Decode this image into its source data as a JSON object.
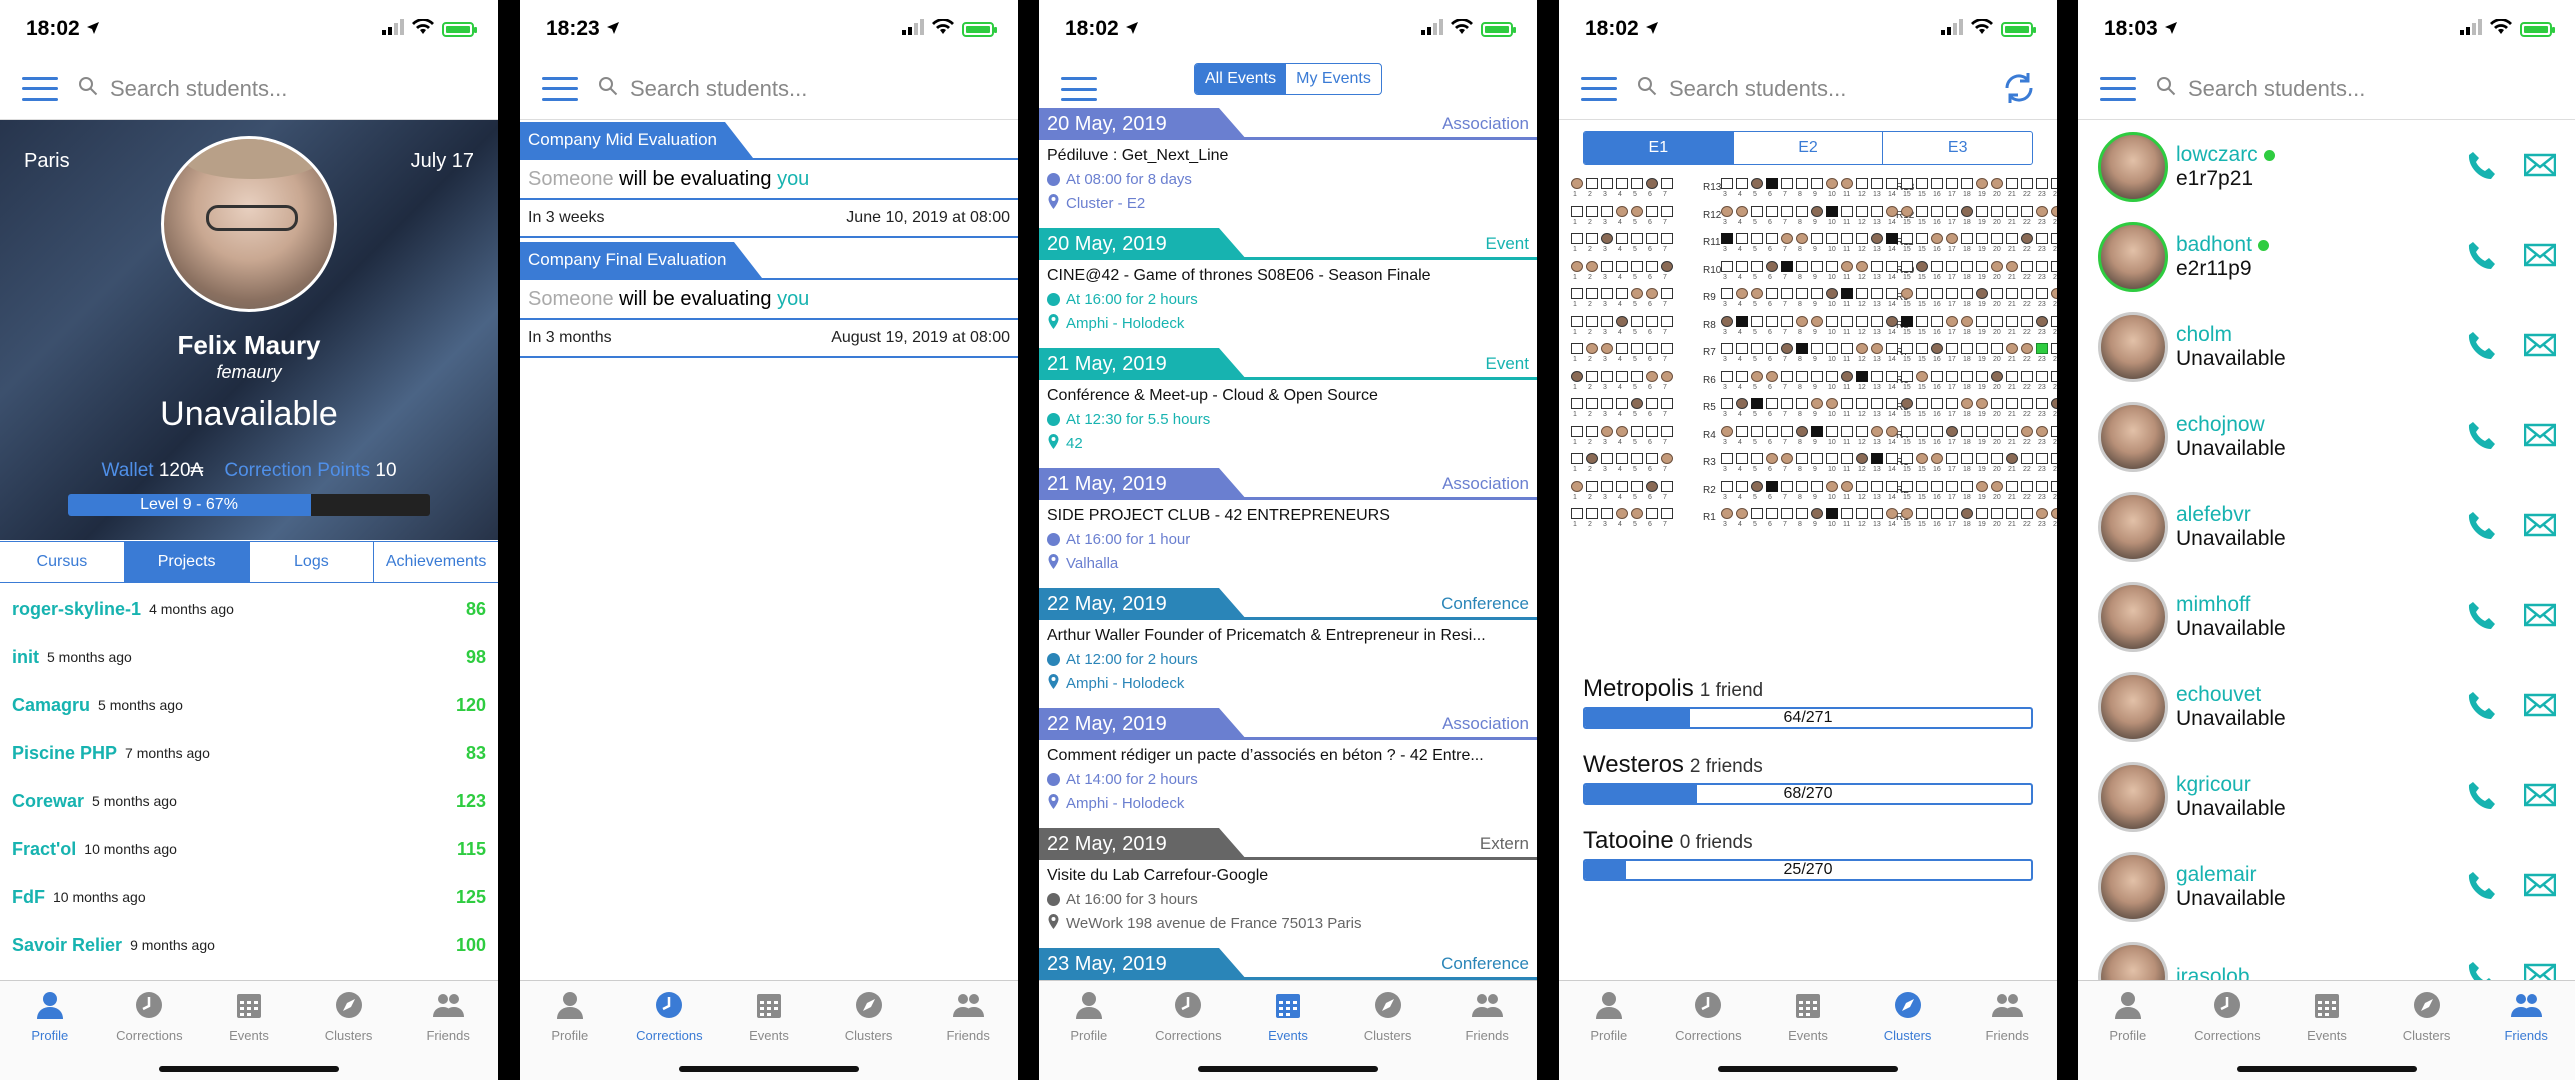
{
  "colors": {
    "accent": "#3a7bd5",
    "teal": "#17b3b0",
    "green": "#2ecc40",
    "purple": "#6a7fd0",
    "gray": "#666666"
  },
  "screens": [
    {
      "time": "18:02"
    },
    {
      "time": "18:23"
    },
    {
      "time": "18:02"
    },
    {
      "time": "18:02"
    },
    {
      "time": "18:03"
    }
  ],
  "search_placeholder": "Search students...",
  "tabs": [
    {
      "label": "Profile",
      "icon": "person-icon"
    },
    {
      "label": "Corrections",
      "icon": "clock-icon"
    },
    {
      "label": "Events",
      "icon": "calendar-icon"
    },
    {
      "label": "Clusters",
      "icon": "compass-icon"
    },
    {
      "label": "Friends",
      "icon": "people-icon"
    }
  ],
  "profile": {
    "city": "Paris",
    "date": "July 17",
    "name": "Felix Maury",
    "login": "femaury",
    "status": "Unavailable",
    "wallet_label": "Wallet",
    "wallet_value": "120₳",
    "cp_label": "Correction Points",
    "cp_value": "10",
    "level_text": "Level 9 - 67%",
    "level_progress": 0.67,
    "segments": [
      "Cursus",
      "Projects",
      "Logs",
      "Achievements"
    ],
    "projects": [
      {
        "name": "roger-skyline-1",
        "time": "4 months ago",
        "score": "86"
      },
      {
        "name": "init",
        "time": "5 months ago",
        "score": "98"
      },
      {
        "name": "Camagru",
        "time": "5 months ago",
        "score": "120"
      },
      {
        "name": "Piscine PHP",
        "time": "7 months ago",
        "score": "83"
      },
      {
        "name": "Corewar",
        "time": "5 months ago",
        "score": "123"
      },
      {
        "name": "Fract'ol",
        "time": "10 months ago",
        "score": "115"
      },
      {
        "name": "FdF",
        "time": "10 months ago",
        "score": "125"
      },
      {
        "name": "Savoir Relier",
        "time": "9 months ago",
        "score": "100"
      }
    ]
  },
  "corrections": [
    {
      "title": "Company Mid Evaluation",
      "someone": "Someone",
      "middle": " will be evaluating ",
      "you": "you",
      "when": "In 3 weeks",
      "date": "June 10, 2019 at 08:00"
    },
    {
      "title": "Company Final Evaluation",
      "someone": "Someone",
      "middle": " will be evaluating ",
      "you": "you",
      "when": "In 3 months",
      "date": "August 19, 2019 at 08:00"
    }
  ],
  "events_toggle": [
    "All Events",
    "My Events"
  ],
  "events": [
    {
      "date": "20 May, 2019",
      "category": "Association",
      "color": "#6a7fd0",
      "title": "Pédiluve : Get_Next_Line",
      "when": "At 08:00 for 8 days",
      "where": "Cluster - E2"
    },
    {
      "date": "20 May, 2019",
      "category": "Event",
      "color": "#17b3b0",
      "title": "CINE@42 - Game of thrones S08E06 - Season Finale",
      "when": "At 16:00 for 2 hours",
      "where": "Amphi - Holodeck"
    },
    {
      "date": "21 May, 2019",
      "category": "Event",
      "color": "#17b3b0",
      "title": "Conférence & Meet-up - Cloud & Open Source",
      "when": "At 12:30 for 5.5 hours",
      "where": "42"
    },
    {
      "date": "21 May, 2019",
      "category": "Association",
      "color": "#6a7fd0",
      "title": "SIDE PROJECT CLUB - 42 ENTREPRENEURS",
      "when": "At 16:00 for 1 hour",
      "where": "Valhalla"
    },
    {
      "date": "22 May, 2019",
      "category": "Conference",
      "color": "#2a85b8",
      "title": "Arthur Waller Founder of Pricematch & Entrepreneur in Resi...",
      "when": "At 12:00 for 2 hours",
      "where": "Amphi - Holodeck"
    },
    {
      "date": "22 May, 2019",
      "category": "Association",
      "color": "#6a7fd0",
      "title": "Comment rédiger un pacte d’associés en béton ? - 42 Entre...",
      "when": "At 14:00 for 2 hours",
      "where": "Amphi - Holodeck"
    },
    {
      "date": "22 May, 2019",
      "category": "Extern",
      "color": "#666666",
      "title": "Visite du Lab Carrefour-Google",
      "when": "At 16:00 for 3 hours",
      "where": "WeWork 198 avenue de France 75013 Paris"
    },
    {
      "date": "23 May, 2019",
      "category": "Conference",
      "color": "#2a85b8",
      "title": "",
      "when": "",
      "where": ""
    }
  ],
  "cluster_tabs": [
    "E1",
    "E2",
    "E3"
  ],
  "row_labels": [
    "R13",
    "R12",
    "R11",
    "R10",
    "R9",
    "R8",
    "R7",
    "R6",
    "R5",
    "R4",
    "R3",
    "R2",
    "R1"
  ],
  "clusters": [
    {
      "name": "Metropolis",
      "friends": "1 friend",
      "used": 64,
      "total": 271,
      "text": "64/271"
    },
    {
      "name": "Westeros",
      "friends": "2 friends",
      "used": 68,
      "total": 270,
      "text": "68/270"
    },
    {
      "name": "Tatooine",
      "friends": "0 friends",
      "used": 25,
      "total": 270,
      "text": "25/270"
    }
  ],
  "friends": [
    {
      "login": "lowczarc",
      "status": "e1r7p21",
      "online": true
    },
    {
      "login": "badhont",
      "status": "e2r11p9",
      "online": true
    },
    {
      "login": "cholm",
      "status": "Unavailable",
      "online": false
    },
    {
      "login": "echojnow",
      "status": "Unavailable",
      "online": false
    },
    {
      "login": "alefebvr",
      "status": "Unavailable",
      "online": false
    },
    {
      "login": "mimhoff",
      "status": "Unavailable",
      "online": false
    },
    {
      "login": "echouvet",
      "status": "Unavailable",
      "online": false
    },
    {
      "login": "kgricour",
      "status": "Unavailable",
      "online": false
    },
    {
      "login": "galemair",
      "status": "Unavailable",
      "online": false
    },
    {
      "login": "irasolob",
      "status": "",
      "online": false
    }
  ]
}
